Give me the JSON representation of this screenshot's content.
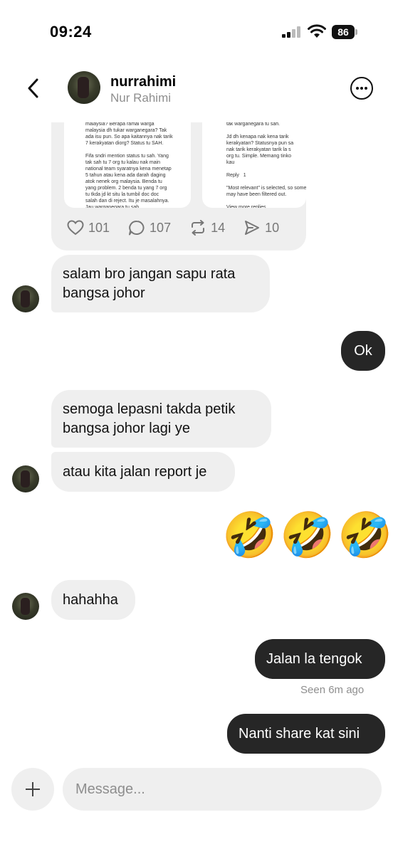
{
  "status_bar": {
    "time": "09:24",
    "battery": "86"
  },
  "header": {
    "username": "nurrahimi",
    "full_name": "Nur Rahimi"
  },
  "shared_post": {
    "left_text": [
      "malaysia? Berapa ramai warga",
      "malaysia dh tukar warganegara? Tak",
      "ada isu pun. So apa kaitannya nak tarik",
      "7 kerakyatan diorg? Status tu SAH.",
      "",
      "Fifa sndri mention status tu sah. Yang",
      "tak sah tu 7 org tu kalau nak main",
      "national team syaratnya kena menetap",
      "5 tahun atau kena ada darah daging",
      "atok nenek org malaysia. Benda tu",
      "yang problem. 2 benda tu yang 7 org",
      "tu tkda jd kt situ la tumbil doc doc",
      "salah dan di reject. Itu je masalahnya.",
      "Jau warganegara tu sah"
    ],
    "right_text": [
      "tak warganegara tu sah.",
      "",
      "Jd dh kenapa nak kena tarik",
      "kerakyatan? Statusnya pun sa",
      "nak tarik kerakyatan tarik la s",
      "org tu. Simple. Memang tinko",
      "kau",
      "",
      "Reply   1",
      "",
      "\"Most relevant\" is selected, so some",
      "may have been filtered out.",
      "",
      "View more replies"
    ],
    "likes": "101",
    "comments": "107",
    "reposts": "14",
    "shares": "10"
  },
  "messages": [
    {
      "id": "m1",
      "direction": "in",
      "text_lines": [
        "salam bro jangan sapu rata",
        "bangsa johor"
      ]
    },
    {
      "id": "m2",
      "direction": "out",
      "text_lines": [
        "Ok"
      ]
    },
    {
      "id": "m3",
      "direction": "in",
      "text_lines": [
        "semoga lepasni takda petik",
        "bangsa johor lagi ye"
      ]
    },
    {
      "id": "m4",
      "direction": "in",
      "text_lines": [
        "atau kita jalan report je"
      ]
    },
    {
      "id": "m5",
      "direction": "out",
      "text_lines": [
        "🤣🤣🤣"
      ]
    },
    {
      "id": "m6",
      "direction": "in",
      "text_lines": [
        "hahahha"
      ]
    },
    {
      "id": "m7",
      "direction": "out",
      "text_lines": [
        "Jalan la tengok"
      ]
    },
    {
      "id": "m8",
      "direction": "out",
      "text_lines": [
        "Nanti share kat sini"
      ]
    }
  ],
  "emojis": [
    "🤣",
    "🤣",
    "🤣"
  ],
  "seen_status": "Seen 6m ago",
  "composer": {
    "placeholder": "Message..."
  },
  "icons": {
    "back": "chevron-left-icon",
    "more": "more-circle-icon",
    "like": "heart-icon",
    "comment": "comment-icon",
    "repost": "repost-icon",
    "share": "send-icon",
    "add": "plus-icon"
  },
  "colors": {
    "incoming_bubble": "#efefef",
    "outgoing_bubble": "#262626",
    "muted_text": "#8e8e8e"
  }
}
